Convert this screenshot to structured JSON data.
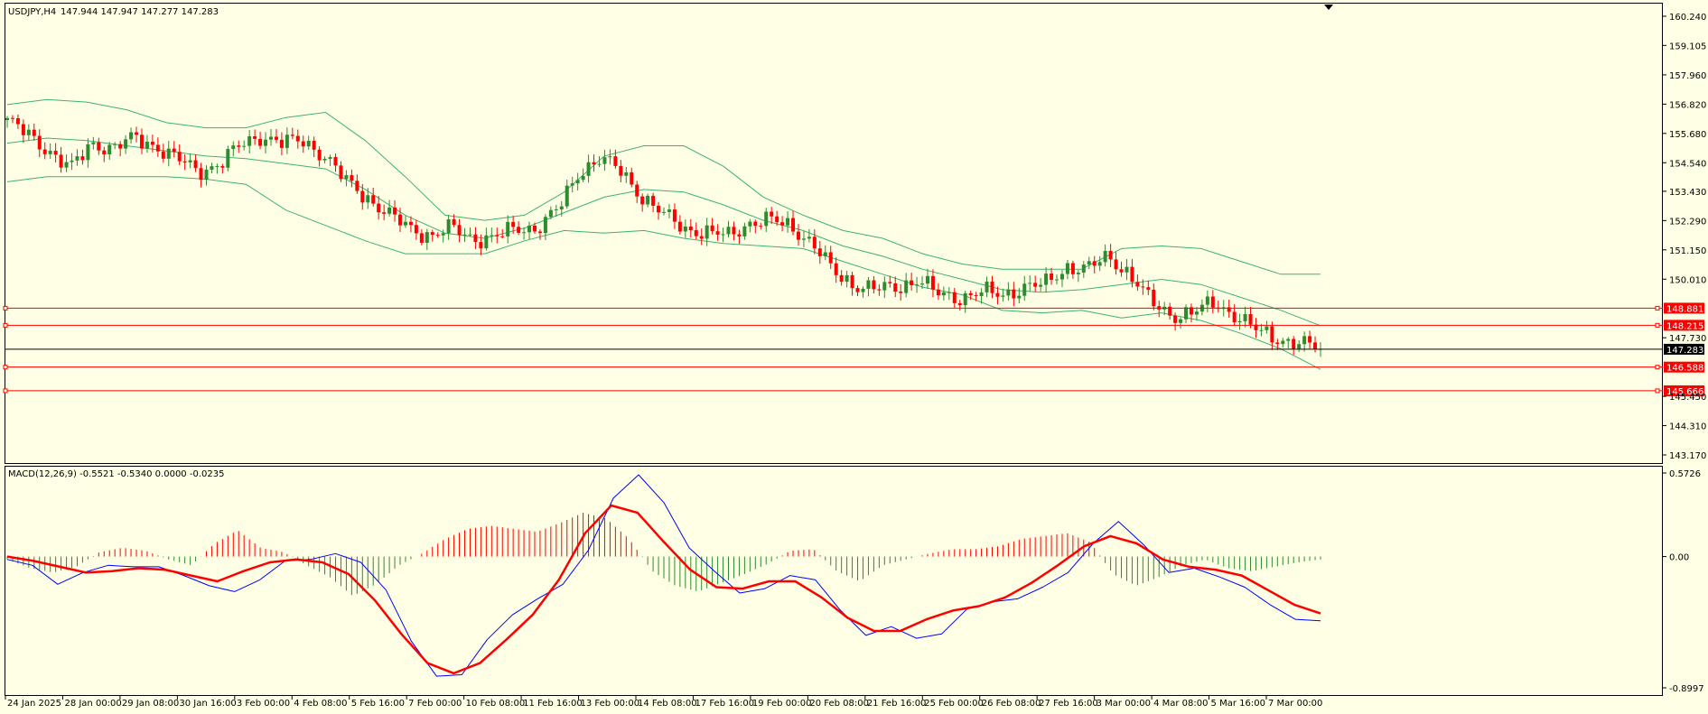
{
  "header": {
    "symbol": "USDJPY,H4",
    "ohlc": "147.944 147.947 147.277 147.283"
  },
  "macd_header": "MACD(12,26,9) -0.5521 -0.5340 0.0000 -0.0235",
  "colors": {
    "background": "#ffffe6",
    "bull": "#2e8b2e",
    "bear": "#ff0000",
    "band": "#3cb371",
    "level": "#ff0000",
    "macd_line": "#0000ff",
    "signal_line": "#ff0000"
  },
  "chart_data": {
    "type": "candlestick",
    "price_axis": {
      "range": [
        143.17,
        160.24
      ],
      "ticks": [
        "160.240",
        "159.105",
        "157.960",
        "156.820",
        "155.680",
        "154.540",
        "153.430",
        "152.290",
        "151.150",
        "150.010",
        "147.730",
        "145.450",
        "144.310",
        "143.170"
      ]
    },
    "current_price": "147.283",
    "levels": [
      "148.881",
      "148.215",
      "146.588",
      "145.666"
    ],
    "time_labels": [
      "24 Jan 2025",
      "28 Jan 00:00",
      "29 Jan 08:00",
      "30 Jan 16:00",
      "3 Feb 00:00",
      "4 Feb 08:00",
      "5 Feb 16:00",
      "7 Feb 00:00",
      "10 Feb 08:00",
      "11 Feb 16:00",
      "13 Feb 00:00",
      "14 Feb 08:00",
      "17 Feb 16:00",
      "19 Feb 00:00",
      "20 Feb 08:00",
      "21 Feb 16:00",
      "25 Feb 00:00",
      "26 Feb 08:00",
      "27 Feb 16:00",
      "3 Mar 00:00",
      "4 Mar 08:00",
      "5 Mar 16:00",
      "7 Mar 00:00"
    ],
    "close_path": [
      156.2,
      155.6,
      155.0,
      154.3,
      155.3,
      155.1,
      155.5,
      155.2,
      154.7,
      154.2,
      154.5,
      155.2,
      155.6,
      155.3,
      155.4,
      154.8,
      153.8,
      153.2,
      152.5,
      152.0,
      151.7,
      152.0,
      151.6,
      151.6,
      152.0,
      152.0,
      152.7,
      154.2,
      154.7,
      154.2,
      153.2,
      152.5,
      152.0,
      151.8,
      151.7,
      152.2,
      152.3,
      152.1,
      151.4,
      150.3,
      149.8,
      149.6,
      149.7,
      150.0,
      149.4,
      149.3,
      149.5,
      149.4,
      149.7,
      149.8,
      150.5,
      150.4,
      150.9,
      150.2,
      149.1,
      148.6,
      148.7,
      149.1,
      148.6,
      148.0,
      147.7,
      147.5,
      147.3
    ],
    "bollinger": {
      "upper": [
        156.8,
        157.0,
        156.9,
        156.6,
        156.1,
        155.9,
        155.9,
        156.3,
        156.5,
        155.4,
        154.0,
        152.5,
        152.3,
        152.5,
        153.4,
        154.8,
        155.2,
        155.2,
        154.4,
        153.2,
        152.5,
        151.9,
        151.6,
        151.0,
        150.6,
        150.4,
        150.4,
        150.4,
        151.2,
        151.3,
        151.2,
        150.7,
        150.2,
        150.2
      ],
      "middle": [
        155.3,
        155.5,
        155.4,
        155.2,
        155.0,
        154.8,
        154.7,
        154.5,
        154.3,
        153.5,
        152.5,
        151.8,
        151.6,
        152.0,
        152.6,
        153.2,
        153.5,
        153.4,
        152.9,
        152.3,
        151.9,
        151.3,
        150.9,
        150.4,
        150.0,
        149.6,
        149.5,
        149.6,
        149.8,
        150.0,
        149.8,
        149.3,
        148.8,
        148.2
      ],
      "lower": [
        153.8,
        154.0,
        154.0,
        154.0,
        154.0,
        153.9,
        153.7,
        152.7,
        152.1,
        151.5,
        151.0,
        151.0,
        151.0,
        151.5,
        151.9,
        151.8,
        151.9,
        151.6,
        151.4,
        151.3,
        151.2,
        150.7,
        150.2,
        149.7,
        149.4,
        148.8,
        148.7,
        148.8,
        148.5,
        148.7,
        148.4,
        147.9,
        147.3,
        146.5
      ]
    },
    "macd_axis": {
      "range": [
        -0.8997,
        0.5726
      ],
      "ticks": [
        "0.5726",
        "0.00",
        "-0.8997"
      ]
    },
    "macd_line": [
      -0.02,
      -0.06,
      -0.19,
      -0.11,
      -0.06,
      -0.07,
      -0.07,
      -0.13,
      -0.2,
      -0.24,
      -0.16,
      -0.03,
      -0.02,
      0.02,
      -0.04,
      -0.23,
      -0.58,
      -0.82,
      -0.81,
      -0.57,
      -0.4,
      -0.29,
      -0.19,
      0.04,
      0.4,
      0.56,
      0.37,
      0.06,
      -0.1,
      -0.25,
      -0.22,
      -0.13,
      -0.16,
      -0.37,
      -0.54,
      -0.48,
      -0.56,
      -0.53,
      -0.36,
      -0.31,
      -0.29,
      -0.21,
      -0.11,
      0.09,
      0.24,
      0.08,
      -0.11,
      -0.08,
      -0.14,
      -0.21,
      -0.33,
      -0.43,
      -0.44
    ],
    "signal_line": [
      0.0,
      -0.03,
      -0.07,
      -0.11,
      -0.1,
      -0.08,
      -0.09,
      -0.13,
      -0.17,
      -0.1,
      -0.04,
      -0.02,
      -0.04,
      -0.12,
      -0.3,
      -0.53,
      -0.73,
      -0.8,
      -0.73,
      -0.57,
      -0.4,
      -0.16,
      0.16,
      0.35,
      0.3,
      0.1,
      -0.09,
      -0.21,
      -0.22,
      -0.17,
      -0.17,
      -0.28,
      -0.42,
      -0.51,
      -0.51,
      -0.43,
      -0.37,
      -0.34,
      -0.28,
      -0.18,
      -0.06,
      0.07,
      0.14,
      0.09,
      -0.02,
      -0.07,
      -0.09,
      -0.13,
      -0.23,
      -0.33,
      -0.39
    ],
    "histogram": [
      -0.02,
      -0.08,
      -0.11,
      -0.07,
      0.03,
      0.06,
      0.04,
      -0.02,
      -0.06,
      0.09,
      0.18,
      0.06,
      0.03,
      -0.06,
      -0.14,
      -0.27,
      -0.19,
      -0.06,
      0.02,
      0.12,
      0.19,
      0.21,
      0.19,
      0.17,
      0.23,
      0.3,
      0.26,
      0.12,
      -0.1,
      -0.2,
      -0.24,
      -0.18,
      -0.12,
      -0.05,
      0.04,
      0.05,
      -0.1,
      -0.17,
      -0.06,
      -0.02,
      0.02,
      0.05,
      0.05,
      0.07,
      0.12,
      0.14,
      0.16,
      0.1,
      -0.12,
      -0.2,
      -0.14,
      -0.06,
      -0.02,
      -0.08,
      -0.1,
      -0.07,
      -0.04,
      -0.02
    ]
  }
}
